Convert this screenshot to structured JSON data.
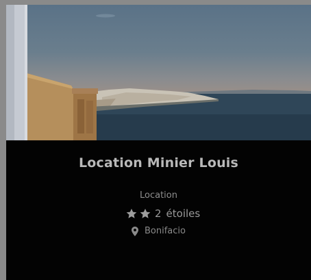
{
  "card": {
    "title": "Location Minier Louis",
    "category": "Location",
    "stars_count": "2",
    "stars_label": "étoiles",
    "stars_icons": [
      "star-icon",
      "star-icon"
    ],
    "location_icon": "map-pin-icon",
    "city": "Bonifacio"
  },
  "colors": {
    "page_background": "#8a8a8a",
    "card_background": "#030303",
    "title": "#b9b9b9",
    "muted_text": "#8d8d8d"
  }
}
